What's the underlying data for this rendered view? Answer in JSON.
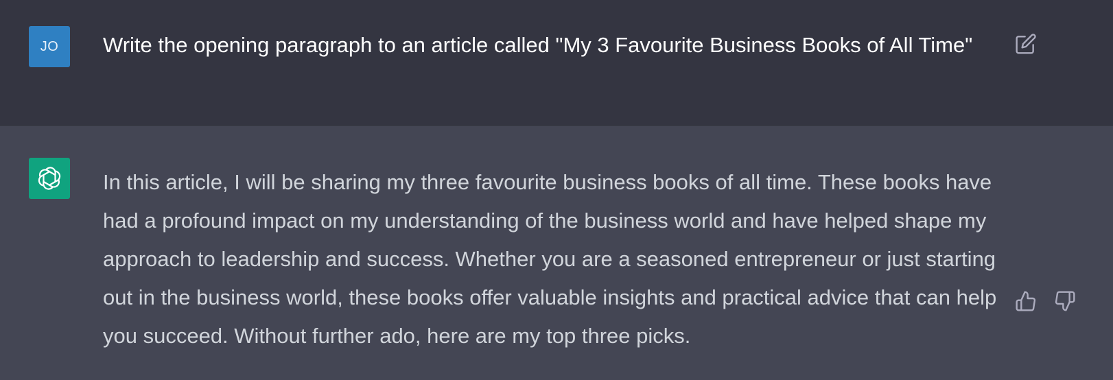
{
  "user_message": {
    "avatar_initials": "JO",
    "avatar_color": "#2f80c2",
    "text": "Write the opening paragraph to an article called \"My 3 Favourite Business Books of All Time\"",
    "edit_icon": "edit-icon"
  },
  "assistant_message": {
    "avatar_icon": "openai-logo-icon",
    "avatar_color": "#10a37f",
    "text": "In this article, I will be sharing my three favourite business books of all time. These books have had a profound impact on my understanding of the business world and have helped shape my approach to leadership and success. Whether you are a seasoned entrepreneur or just starting out in the business world, these books offer valuable insights and practical advice that can help you succeed. Without further ado, here are my top three picks.",
    "like_icon": "thumbs-up-icon",
    "dislike_icon": "thumbs-down-icon"
  },
  "colors": {
    "user_bg": "#343541",
    "assistant_bg": "#444654",
    "text": "#ececf1",
    "icon": "#acacbe"
  }
}
